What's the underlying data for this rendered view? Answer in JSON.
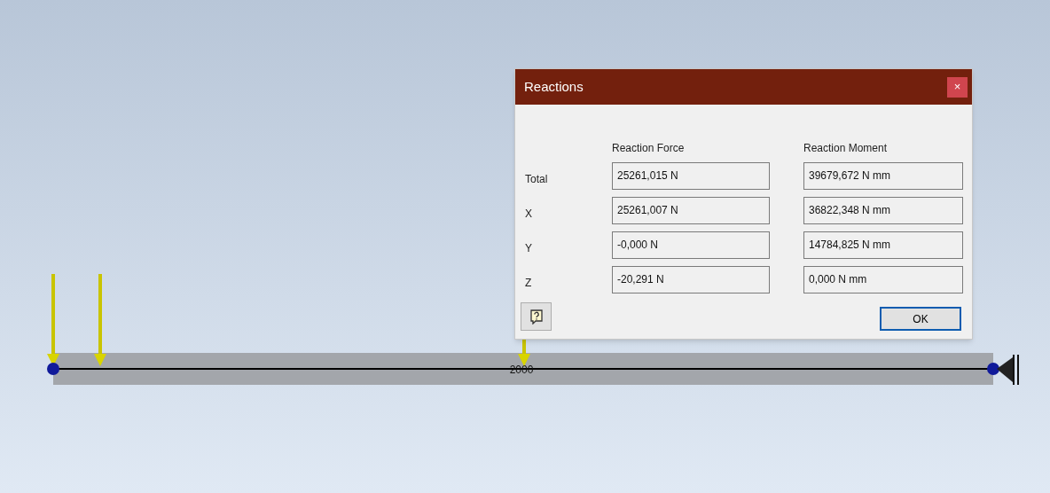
{
  "beam": {
    "dimension_label": "2000"
  },
  "dialog": {
    "title": "Reactions",
    "close_button": "×",
    "columns": [
      "Reaction Force",
      "Reaction Moment"
    ],
    "rows": [
      {
        "label": "Total",
        "force": "25261,015 N",
        "moment": "39679,672 N mm"
      },
      {
        "label": "X",
        "force": "25261,007 N",
        "moment": "36822,348 N mm"
      },
      {
        "label": "Y",
        "force": "-0,000 N",
        "moment": "14784,825 N mm"
      },
      {
        "label": "Z",
        "force": "-20,291 N",
        "moment": "0,000 N mm"
      }
    ],
    "ok_button": "OK"
  }
}
